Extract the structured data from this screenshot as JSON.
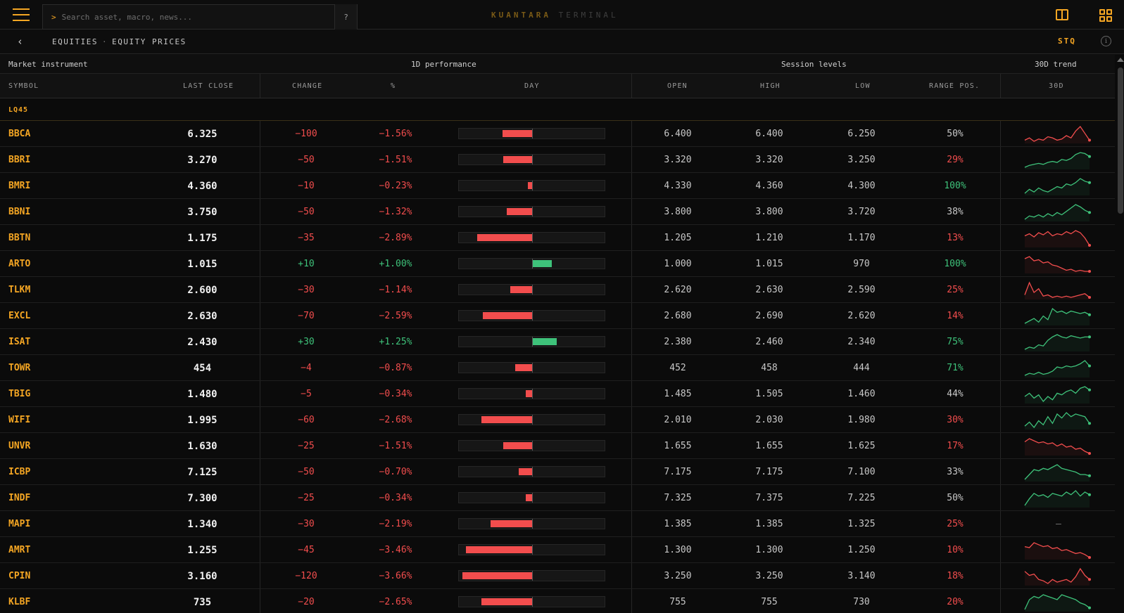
{
  "topbar": {
    "search_prompt": ">",
    "search_placeholder": "Search asset, macro, news...",
    "help_label": "?",
    "brand_primary": "KUANTARA",
    "brand_secondary": "TERMINAL",
    "icons": [
      "menu-icon",
      "split-view-icon",
      "grid-view-icon"
    ]
  },
  "subbar": {
    "back_label": "‹",
    "crumb_section": "EQUITIES",
    "crumb_separator": "·",
    "crumb_page": "EQUITY PRICES",
    "source_label": "STQ",
    "info_label": "i"
  },
  "groups": {
    "instrument": "Market instrument",
    "performance": "1D performance",
    "session": "Session levels",
    "trend": "30D trend"
  },
  "columns": {
    "symbol": "SYMBOL",
    "last_close": "LAST CLOSE",
    "change": "CHANGE",
    "pct": "%",
    "day": "DAY",
    "open": "OPEN",
    "high": "HIGH",
    "low": "LOW",
    "range_pos": "RANGE POS.",
    "trend": "30D"
  },
  "section_label": "LQ45",
  "no_trend_placeholder": "–",
  "colors": {
    "accent": "#f5a623",
    "negative": "#f24d4d",
    "positive": "#3ec27a"
  },
  "rows": [
    {
      "symbol": "BBCA",
      "last": "6.325",
      "change": "−100",
      "pct": "−1.56%",
      "pct_value": -1.56,
      "open": "6.400",
      "high": "6.400",
      "low": "6.250",
      "range": "50%",
      "range_tone": "neutral",
      "trend": [
        10,
        12,
        9,
        11,
        10,
        13,
        12,
        10,
        11,
        14,
        12,
        18,
        22,
        16,
        10
      ],
      "trend_dir": "down"
    },
    {
      "symbol": "BBRI",
      "last": "3.270",
      "change": "−50",
      "pct": "−1.51%",
      "pct_value": -1.51,
      "open": "3.320",
      "high": "3.320",
      "low": "3.250",
      "range": "29%",
      "range_tone": "neg",
      "trend": [
        5,
        7,
        8,
        9,
        8,
        10,
        11,
        10,
        13,
        12,
        14,
        18,
        20,
        19,
        16
      ],
      "trend_dir": "up"
    },
    {
      "symbol": "BMRI",
      "last": "4.360",
      "change": "−10",
      "pct": "−0.23%",
      "pct_value": -0.23,
      "open": "4.330",
      "high": "4.360",
      "low": "4.300",
      "range": "100%",
      "range_tone": "pos",
      "trend": [
        8,
        11,
        9,
        12,
        10,
        9,
        11,
        13,
        12,
        15,
        14,
        16,
        19,
        17,
        16
      ],
      "trend_dir": "up"
    },
    {
      "symbol": "BBNI",
      "last": "3.750",
      "change": "−50",
      "pct": "−1.32%",
      "pct_value": -1.32,
      "open": "3.800",
      "high": "3.800",
      "low": "3.720",
      "range": "38%",
      "range_tone": "neutral",
      "trend": [
        6,
        9,
        8,
        10,
        8,
        11,
        9,
        12,
        10,
        13,
        16,
        19,
        17,
        14,
        12
      ],
      "trend_dir": "up"
    },
    {
      "symbol": "BBTN",
      "last": "1.175",
      "change": "−35",
      "pct": "−2.89%",
      "pct_value": -2.89,
      "open": "1.205",
      "high": "1.210",
      "low": "1.170",
      "range": "13%",
      "range_tone": "neg",
      "trend": [
        14,
        16,
        13,
        17,
        15,
        18,
        14,
        16,
        15,
        18,
        16,
        19,
        17,
        12,
        5
      ],
      "trend_dir": "down"
    },
    {
      "symbol": "ARTO",
      "last": "1.015",
      "change": "+10",
      "pct": "+1.00%",
      "pct_value": 1.0,
      "open": "1.000",
      "high": "1.015",
      "low": "970",
      "range": "100%",
      "range_tone": "pos",
      "trend": [
        18,
        20,
        16,
        17,
        14,
        15,
        12,
        11,
        9,
        7,
        8,
        6,
        7,
        6,
        6
      ],
      "trend_dir": "down"
    },
    {
      "symbol": "TLKM",
      "last": "2.600",
      "change": "−30",
      "pct": "−1.14%",
      "pct_value": -1.14,
      "open": "2.620",
      "high": "2.630",
      "low": "2.590",
      "range": "25%",
      "range_tone": "neg",
      "trend": [
        10,
        20,
        12,
        15,
        9,
        10,
        8,
        9,
        8,
        9,
        8,
        9,
        10,
        11,
        8
      ],
      "trend_dir": "down"
    },
    {
      "symbol": "EXCL",
      "last": "2.630",
      "change": "−70",
      "pct": "−2.59%",
      "pct_value": -2.59,
      "open": "2.680",
      "high": "2.690",
      "low": "2.620",
      "range": "14%",
      "range_tone": "neg",
      "trend": [
        6,
        8,
        10,
        7,
        12,
        9,
        18,
        15,
        16,
        14,
        16,
        15,
        14,
        15,
        13
      ],
      "trend_dir": "up"
    },
    {
      "symbol": "ISAT",
      "last": "2.430",
      "change": "+30",
      "pct": "+1.25%",
      "pct_value": 1.25,
      "open": "2.380",
      "high": "2.460",
      "low": "2.340",
      "range": "75%",
      "range_tone": "pos",
      "trend": [
        5,
        7,
        6,
        9,
        8,
        13,
        16,
        18,
        16,
        15,
        17,
        16,
        15,
        16,
        16
      ],
      "trend_dir": "up"
    },
    {
      "symbol": "TOWR",
      "last": "454",
      "change": "−4",
      "pct": "−0.87%",
      "pct_value": -0.87,
      "open": "452",
      "high": "458",
      "low": "444",
      "range": "71%",
      "range_tone": "pos",
      "trend": [
        8,
        10,
        9,
        11,
        9,
        10,
        12,
        16,
        15,
        17,
        16,
        17,
        19,
        22,
        17
      ],
      "trend_dir": "up"
    },
    {
      "symbol": "TBIG",
      "last": "1.480",
      "change": "−5",
      "pct": "−0.34%",
      "pct_value": -0.34,
      "open": "1.485",
      "high": "1.505",
      "low": "1.460",
      "range": "44%",
      "range_tone": "neutral",
      "trend": [
        12,
        14,
        11,
        13,
        9,
        12,
        10,
        14,
        13,
        15,
        16,
        14,
        17,
        18,
        16
      ],
      "trend_dir": "up"
    },
    {
      "symbol": "WIFI",
      "last": "1.995",
      "change": "−60",
      "pct": "−2.68%",
      "pct_value": -2.68,
      "open": "2.010",
      "high": "2.030",
      "low": "1.980",
      "range": "30%",
      "range_tone": "neg",
      "trend": [
        8,
        11,
        7,
        12,
        9,
        15,
        10,
        17,
        14,
        18,
        15,
        17,
        16,
        15,
        10
      ],
      "trend_dir": "up"
    },
    {
      "symbol": "UNVR",
      "last": "1.630",
      "change": "−25",
      "pct": "−1.51%",
      "pct_value": -1.51,
      "open": "1.655",
      "high": "1.655",
      "low": "1.625",
      "range": "17%",
      "range_tone": "neg",
      "trend": [
        16,
        19,
        17,
        15,
        16,
        14,
        15,
        12,
        14,
        11,
        12,
        9,
        10,
        7,
        5
      ],
      "trend_dir": "down"
    },
    {
      "symbol": "ICBP",
      "last": "7.125",
      "change": "−50",
      "pct": "−0.70%",
      "pct_value": -0.7,
      "open": "7.175",
      "high": "7.175",
      "low": "7.100",
      "range": "33%",
      "range_tone": "neutral",
      "trend": [
        6,
        10,
        14,
        13,
        15,
        14,
        16,
        18,
        15,
        14,
        13,
        12,
        10,
        10,
        9
      ],
      "trend_dir": "up"
    },
    {
      "symbol": "INDF",
      "last": "7.300",
      "change": "−25",
      "pct": "−0.34%",
      "pct_value": -0.34,
      "open": "7.325",
      "high": "7.375",
      "low": "7.225",
      "range": "50%",
      "range_tone": "neutral",
      "trend": [
        5,
        10,
        14,
        12,
        13,
        11,
        14,
        13,
        12,
        15,
        13,
        16,
        12,
        15,
        13
      ],
      "trend_dir": "up"
    },
    {
      "symbol": "MAPI",
      "last": "1.340",
      "change": "−30",
      "pct": "−2.19%",
      "pct_value": -2.19,
      "open": "1.385",
      "high": "1.385",
      "low": "1.325",
      "range": "25%",
      "range_tone": "neg",
      "trend": [],
      "trend_dir": "none"
    },
    {
      "symbol": "AMRT",
      "last": "1.255",
      "change": "−45",
      "pct": "−3.46%",
      "pct_value": -3.46,
      "open": "1.300",
      "high": "1.300",
      "low": "1.250",
      "range": "10%",
      "range_tone": "neg",
      "trend": [
        16,
        15,
        20,
        18,
        16,
        17,
        14,
        15,
        12,
        13,
        11,
        9,
        10,
        8,
        5
      ],
      "trend_dir": "down"
    },
    {
      "symbol": "CPIN",
      "last": "3.160",
      "change": "−120",
      "pct": "−3.66%",
      "pct_value": -3.66,
      "open": "3.250",
      "high": "3.250",
      "low": "3.140",
      "range": "18%",
      "range_tone": "neg",
      "trend": [
        16,
        13,
        14,
        10,
        9,
        7,
        10,
        8,
        9,
        10,
        8,
        12,
        18,
        13,
        10
      ],
      "trend_dir": "down"
    },
    {
      "symbol": "KLBF",
      "last": "735",
      "change": "−20",
      "pct": "−2.65%",
      "pct_value": -2.65,
      "open": "755",
      "high": "755",
      "low": "730",
      "range": "20%",
      "range_tone": "neg",
      "trend": [
        6,
        12,
        14,
        13,
        15,
        14,
        13,
        12,
        15,
        14,
        13,
        12,
        10,
        9,
        7
      ],
      "trend_dir": "up"
    }
  ]
}
